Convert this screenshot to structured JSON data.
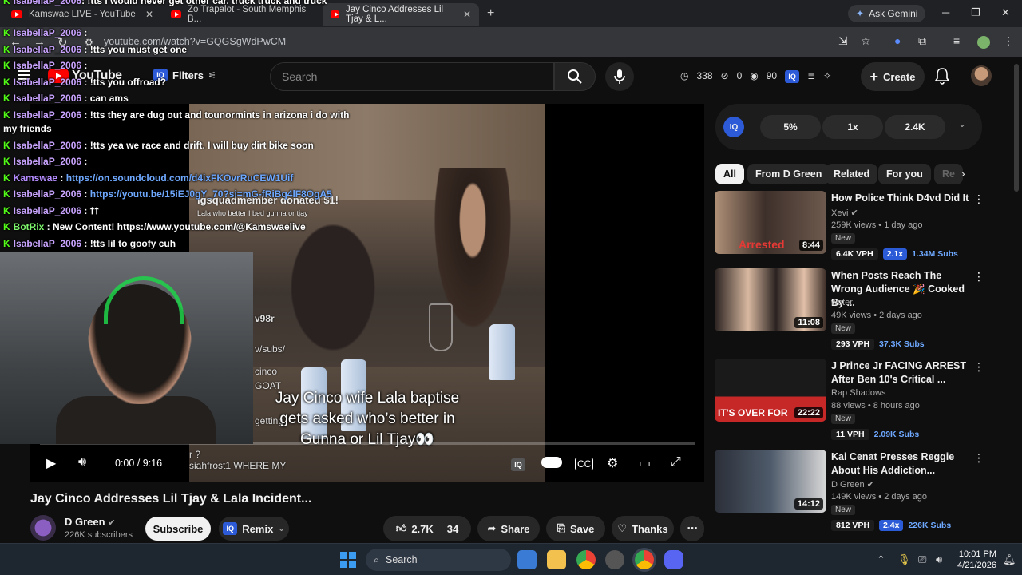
{
  "browser": {
    "tabs": [
      {
        "title": "Kamswae LIVE - YouTube"
      },
      {
        "title": "Zo Trapalot - South Memphis B..."
      },
      {
        "title": "Jay Cinco Addresses Lil Tjay & L..."
      }
    ],
    "gemini_label": "Ask Gemini",
    "url": "youtube.com/watch?v=GQGSgWdPwCM"
  },
  "header": {
    "logo_text": "YouTube",
    "filters_label": "Filters",
    "search_placeholder": "Search",
    "stats": {
      "watch": "338",
      "likes": "0",
      "views": "90"
    },
    "create_label": "Create"
  },
  "chat": [
    {
      "user": "IsabellaP_2006",
      "msg": ": !tts i would never get other car. truck truck and truck"
    },
    {
      "user": "IsabellaP_2006",
      "msg": " :"
    },
    {
      "user": "IsabellaP_2006",
      "msg": " : !tts you must get one"
    },
    {
      "user": "IsabellaP_2006",
      "msg": " :"
    },
    {
      "user": "IsabellaP_2006",
      "msg": " : !tts you offroad?"
    },
    {
      "user": "IsabellaP_2006",
      "msg": " : can ams"
    },
    {
      "user": "IsabellaP_2006",
      "msg": " : !tts they are dug out and tounormints in arizona i do with"
    },
    {
      "user": "",
      "msg": "my friends"
    },
    {
      "user": "IsabellaP_2006",
      "msg": " : !tts yea we race and drift. I will buy dirt bike soon"
    },
    {
      "user": "IsabellaP_2006",
      "msg": " :"
    },
    {
      "user": "Kamswae",
      "msg": " : ",
      "link": "https://on.soundcloud.com/d4ixFKOvrRuCEW1Uif"
    },
    {
      "user": "IsabellaP_2006",
      "msg": " : ",
      "link": "https://youtu.be/15iEJ0gY_70?si=mG-fRiBq4lF8OgA5"
    },
    {
      "user": "IsabellaP_2006",
      "msg": " : ⭡⭡"
    },
    {
      "user": "BotRix",
      "msg": " : New Content! https://www.youtube.com/@Kamswaelive"
    },
    {
      "user": "IsabellaP_2006",
      "msg": " : !tts lil to goofy cuh"
    }
  ],
  "video": {
    "caption_line1": "Jay Cinco wife Lala baptise",
    "caption_line2": "gets asked who’s better in",
    "caption_line3": "Gunna or Lil Tjay👀",
    "donation": "igsquadmember donated $1!",
    "donation_sub": "Lala who better I bed gunna or tjay",
    "side1": "v98r",
    "side2": "v/subs/",
    "side3": "cinco",
    "side4": "GOAT",
    "side5": "getting",
    "overlay_bottom1": "r ?",
    "overlay_bottom2": "siahfrost1  WHERE MY",
    "time": "0:00 / 9:16"
  },
  "meta": {
    "title": "Jay Cinco Addresses Lil Tjay & Lala Incident...",
    "channel": "D Green",
    "subs": "226K subscribers",
    "subscribe_label": "Subscribe",
    "remix_label": "Remix",
    "likes": "2.7K",
    "dislikes": "34",
    "share_label": "Share",
    "save_label": "Save",
    "thanks_label": "Thanks"
  },
  "iq": {
    "label": "IQ",
    "pct": "5%",
    "mult": "1x",
    "views": "2.4K"
  },
  "chips": [
    "All",
    "From D Green",
    "Related",
    "For you",
    "Re"
  ],
  "recs": [
    {
      "title": "How Police Think D4vd Did It",
      "channel": "Xevi",
      "meta": "259K views • 1 day ago",
      "duration": "8:44",
      "vph": "6.4K VPH",
      "ratio": "2.1x",
      "subs": "1.34M Subs",
      "badge": "New"
    },
    {
      "title": "When Posts Reach The Wrong Audience 🎉 Cooked By ...",
      "channel": "woter",
      "meta": "49K views • 2 days ago",
      "duration": "11:08",
      "vph": "293 VPH",
      "ratio": "",
      "subs": "37.3K Subs",
      "badge": "New"
    },
    {
      "title": "J Prince Jr FACING ARREST After Ben 10's Critical ...",
      "channel": "Rap Shadows",
      "meta": "88 views • 8 hours ago",
      "duration": "22:22",
      "vph": "11 VPH",
      "ratio": "",
      "subs": "2.09K Subs",
      "badge": "New"
    },
    {
      "title": "Kai Cenat Presses Reggie About His Addiction...",
      "channel": "D Green",
      "meta": "149K views • 2 days ago",
      "duration": "14:12",
      "vph": "812 VPH",
      "ratio": "2.4x",
      "subs": "226K Subs",
      "badge": "New"
    }
  ],
  "taskbar": {
    "search": "Search",
    "time": "10:01 PM",
    "date": "4/21/2026"
  }
}
